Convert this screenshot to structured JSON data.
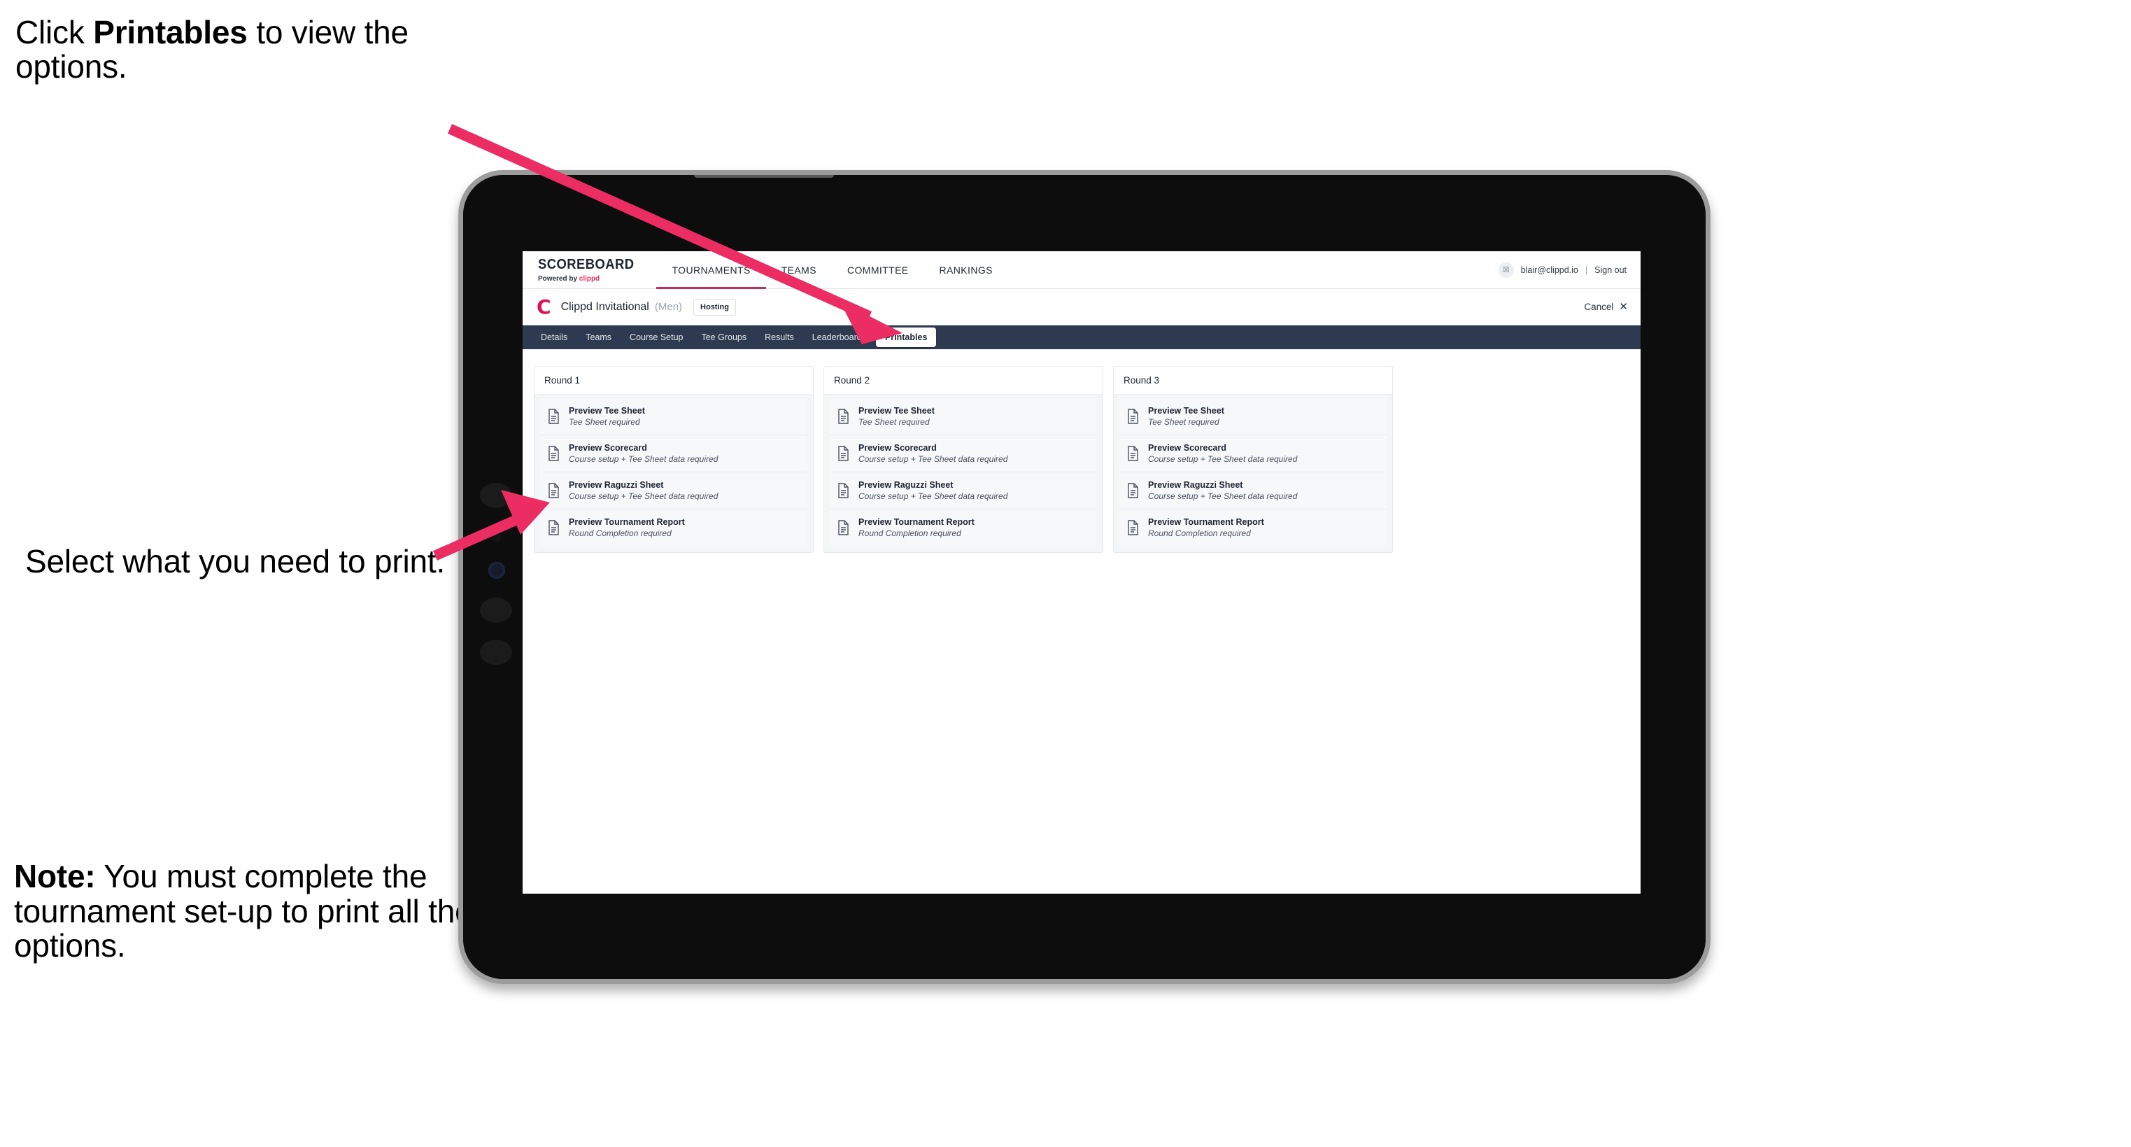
{
  "annotations": {
    "click_printables": {
      "pre": "Click ",
      "bold": "Printables",
      "post": " to view the options."
    },
    "select_print": {
      "text": "Select what you need to print."
    },
    "note": {
      "bold": "Note:",
      "text": " You must complete the tournament set-up to print all the options."
    },
    "arrow_color": "#ec2d64"
  },
  "app": {
    "brand": {
      "title": "SCOREBOARD",
      "sub_prefix": "Powered by ",
      "sub_accent": "clippd"
    },
    "topnav": [
      {
        "label": "TOURNAMENTS",
        "active": true
      },
      {
        "label": "TEAMS",
        "active": false
      },
      {
        "label": "COMMITTEE",
        "active": false
      },
      {
        "label": "RANKINGS",
        "active": false
      }
    ],
    "account": {
      "avatar_glyph": "☒",
      "email": "blair@clippd.io",
      "separator": "|",
      "sign_out": "Sign out"
    },
    "tournament": {
      "logo_letter": "C",
      "name": "Clippd Invitational",
      "gender": "(Men)",
      "status_badge": "Hosting",
      "cancel_label": "Cancel",
      "cancel_icon": "✕"
    },
    "tabs": [
      {
        "label": "Details",
        "active": false
      },
      {
        "label": "Teams",
        "active": false
      },
      {
        "label": "Course Setup",
        "active": false
      },
      {
        "label": "Tee Groups",
        "active": false
      },
      {
        "label": "Results",
        "active": false
      },
      {
        "label": "Leaderboards",
        "active": false
      },
      {
        "label": "Printables",
        "active": true
      }
    ],
    "rounds": [
      {
        "header": "Round 1",
        "items": [
          {
            "title": "Preview Tee Sheet",
            "sub": "Tee Sheet required"
          },
          {
            "title": "Preview Scorecard",
            "sub": "Course setup + Tee Sheet data required"
          },
          {
            "title": "Preview Raguzzi Sheet",
            "sub": "Course setup + Tee Sheet data required"
          },
          {
            "title": "Preview Tournament Report",
            "sub": "Round Completion required"
          }
        ]
      },
      {
        "header": "Round 2",
        "items": [
          {
            "title": "Preview Tee Sheet",
            "sub": "Tee Sheet required"
          },
          {
            "title": "Preview Scorecard",
            "sub": "Course setup + Tee Sheet data required"
          },
          {
            "title": "Preview Raguzzi Sheet",
            "sub": "Course setup + Tee Sheet data required"
          },
          {
            "title": "Preview Tournament Report",
            "sub": "Round Completion required"
          }
        ]
      },
      {
        "header": "Round 3",
        "items": [
          {
            "title": "Preview Tee Sheet",
            "sub": "Tee Sheet required"
          },
          {
            "title": "Preview Scorecard",
            "sub": "Course setup + Tee Sheet data required"
          },
          {
            "title": "Preview Raguzzi Sheet",
            "sub": "Course setup + Tee Sheet data required"
          },
          {
            "title": "Preview Tournament Report",
            "sub": "Round Completion required"
          }
        ]
      }
    ],
    "colors": {
      "tabstrip_bg": "#2d3a50",
      "brand_accent": "#e0114f",
      "active_underline": "#c03058"
    }
  }
}
